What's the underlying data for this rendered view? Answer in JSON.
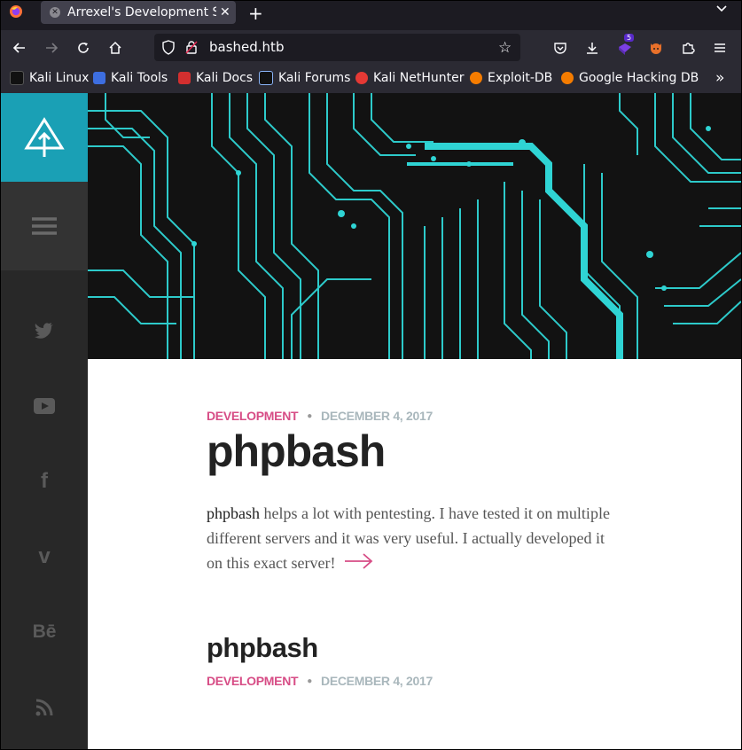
{
  "browser": {
    "tab_title": "Arrexel's Development Site",
    "tab_close": "✕",
    "new_tab": "+",
    "tab_list": "⌄",
    "url": "bashed.htb",
    "extension_badge": "5"
  },
  "bookmarks": [
    {
      "label": "Kali Linux",
      "color": "#4b7bd1"
    },
    {
      "label": "Kali Tools",
      "color": "#3d6ee0"
    },
    {
      "label": "Kali Docs",
      "color": "#d32f2f"
    },
    {
      "label": "Kali Forums",
      "color": "#8ab4f8"
    },
    {
      "label": "Kali NetHunter",
      "color": "#e53935"
    },
    {
      "label": "Exploit-DB",
      "color": "#f57c00"
    },
    {
      "label": "Google Hacking DB",
      "color": "#f57c00"
    }
  ],
  "sidebar": {
    "social": [
      {
        "name": "twitter-icon",
        "glyph": "🐦"
      },
      {
        "name": "youtube-icon",
        "glyph": "▶"
      },
      {
        "name": "facebook-icon",
        "glyph": "f"
      },
      {
        "name": "vimeo-icon",
        "glyph": "v"
      },
      {
        "name": "behance-icon",
        "glyph": "Bē"
      },
      {
        "name": "rss-icon",
        "glyph": "))"
      }
    ]
  },
  "post": {
    "category": "DEVELOPMENT",
    "date": "DECEMBER 4, 2017",
    "title": "phpbash",
    "excerpt_strong": "phpbash",
    "excerpt_rest": " helps a lot with pentesting. I have tested it on multiple different servers and it was very useful. I actually developed it on this exact server!"
  },
  "post2": {
    "title": "phpbash",
    "category": "DEVELOPMENT",
    "date": "DECEMBER 4, 2017"
  },
  "colors": {
    "accent": "#1aa0b5",
    "category": "#d74d86",
    "date": "#a9b7bc",
    "circuit": "#2fd4d4"
  }
}
